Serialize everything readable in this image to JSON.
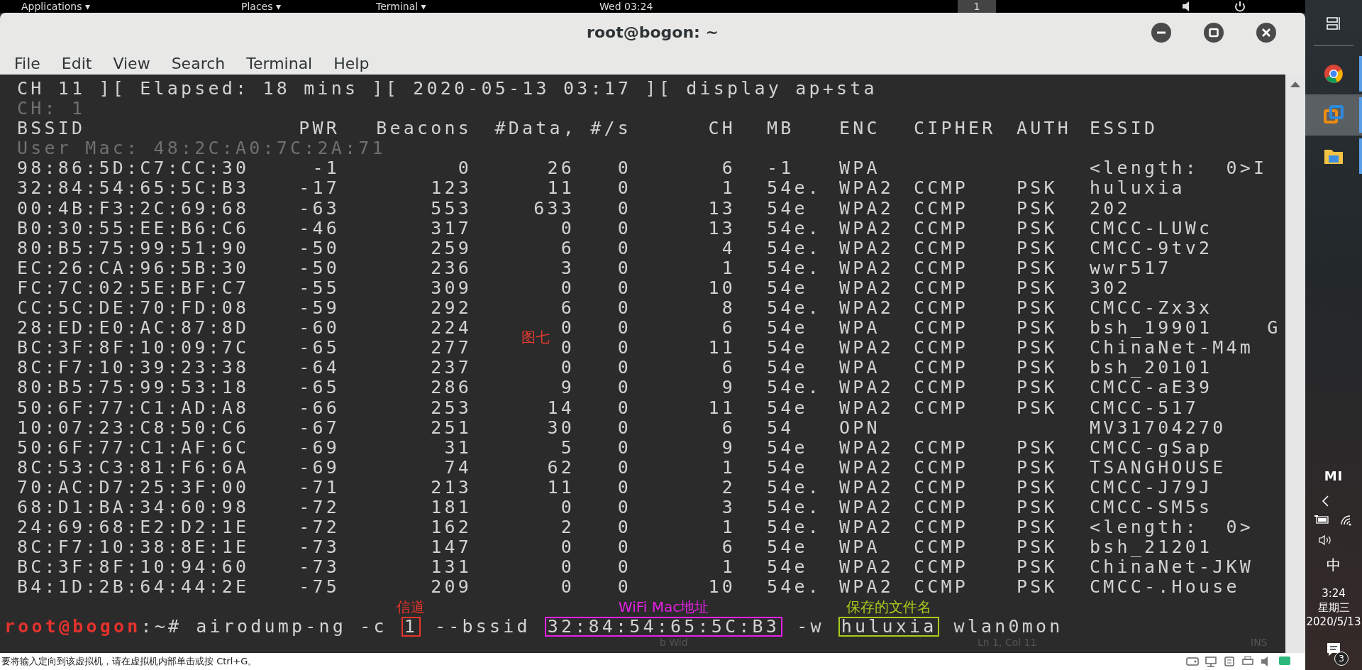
{
  "top_bar": {
    "menus": [
      "Applications ▾",
      "Places ▾",
      "Terminal ▾"
    ],
    "clock": "Wed 03:24",
    "workspace": "1"
  },
  "window": {
    "title": "root@bogon: ~"
  },
  "menu": [
    "File",
    "Edit",
    "View",
    "Search",
    "Terminal",
    "Help"
  ],
  "terminal": {
    "status_line": "CH 11 ][ Elapsed: 18 mins ][ 2020-05-13 03:17 ][ display ap+sta",
    "channel_line": "CH: 1",
    "columns": [
      "BSSID",
      "PWR",
      "Beacons",
      "#Data, #/s",
      "CH",
      "MB",
      "ENC",
      "CIPHER",
      "AUTH",
      "ESSID"
    ],
    "user_mac_line": "User Mac: 48:2C:A0:7C:2A:71",
    "rows": [
      {
        "bssid": "98:86:5D:C7:CC:30",
        "pwr": "-1",
        "beacons": "0",
        "data": "26",
        "rate": "0",
        "ch": "6",
        "mb": "-1",
        "enc": "WPA",
        "essid": "<length:  0>I"
      },
      {
        "bssid": "32:84:54:65:5C:B3",
        "pwr": "-17",
        "beacons": "123",
        "data": "11",
        "rate": "0",
        "ch": "1",
        "mb": "54e.",
        "enc": "WPA2",
        "cipher": "CCMP",
        "auth": "PSK",
        "essid": "huluxia"
      },
      {
        "bssid": "00:4B:F3:2C:69:68",
        "pwr": "-63",
        "beacons": "553",
        "data": "633",
        "rate": "0",
        "ch": "13",
        "mb": "54e",
        "enc": "WPA2",
        "cipher": "CCMP",
        "auth": "PSK",
        "essid": "202"
      },
      {
        "bssid": "B0:30:55:EE:B6:C6",
        "pwr": "-46",
        "beacons": "317",
        "data": "0",
        "rate": "0",
        "ch": "13",
        "mb": "54e.",
        "enc": "WPA2",
        "cipher": "CCMP",
        "auth": "PSK",
        "essid": "CMCC-LUWc"
      },
      {
        "bssid": "80:B5:75:99:51:90",
        "pwr": "-50",
        "beacons": "259",
        "data": "6",
        "rate": "0",
        "ch": "4",
        "mb": "54e.",
        "enc": "WPA2",
        "cipher": "CCMP",
        "auth": "PSK",
        "essid": "CMCC-9tv2"
      },
      {
        "bssid": "EC:26:CA:96:5B:30",
        "pwr": "-50",
        "beacons": "236",
        "data": "3",
        "rate": "0",
        "ch": "1",
        "mb": "54e.",
        "enc": "WPA2",
        "cipher": "CCMP",
        "auth": "PSK",
        "essid": "wwr517"
      },
      {
        "bssid": "FC:7C:02:5E:BF:C7",
        "pwr": "-55",
        "beacons": "309",
        "data": "0",
        "rate": "0",
        "ch": "10",
        "mb": "54e",
        "enc": "WPA2",
        "cipher": "CCMP",
        "auth": "PSK",
        "essid": "302"
      },
      {
        "bssid": "CC:5C:DE:70:FD:08",
        "pwr": "-59",
        "beacons": "292",
        "data": "6",
        "rate": "0",
        "ch": "8",
        "mb": "54e.",
        "enc": "WPA2",
        "cipher": "CCMP",
        "auth": "PSK",
        "essid": "CMCC-Zx3x"
      },
      {
        "bssid": "28:ED:E0:AC:87:8D",
        "pwr": "-60",
        "beacons": "224",
        "data": "0",
        "rate": "0",
        "ch": "6",
        "mb": "54e",
        "enc": "WPA",
        "cipher": "CCMP",
        "auth": "PSK",
        "essid": "bsh_19901    G"
      },
      {
        "bssid": "BC:3F:8F:10:09:7C",
        "pwr": "-65",
        "beacons": "277",
        "data": "0",
        "rate": "0",
        "ch": "11",
        "mb": "54e",
        "enc": "WPA2",
        "cipher": "CCMP",
        "auth": "PSK",
        "essid": "ChinaNet-M4m"
      },
      {
        "bssid": "8C:F7:10:39:23:38",
        "pwr": "-64",
        "beacons": "237",
        "data": "0",
        "rate": "0",
        "ch": "6",
        "mb": "54e",
        "enc": "WPA",
        "cipher": "CCMP",
        "auth": "PSK",
        "essid": "bsh_20101"
      },
      {
        "bssid": "80:B5:75:99:53:18",
        "pwr": "-65",
        "beacons": "286",
        "data": "9",
        "rate": "0",
        "ch": "9",
        "mb": "54e.",
        "enc": "WPA2",
        "cipher": "CCMP",
        "auth": "PSK",
        "essid": "CMCC-aE39"
      },
      {
        "bssid": "50:6F:77:C1:AD:A8",
        "pwr": "-66",
        "beacons": "253",
        "data": "14",
        "rate": "0",
        "ch": "11",
        "mb": "54e",
        "enc": "WPA2",
        "cipher": "CCMP",
        "auth": "PSK",
        "essid": "CMCC-517"
      },
      {
        "bssid": "10:07:23:C8:50:C6",
        "pwr": "-67",
        "beacons": "251",
        "data": "30",
        "rate": "0",
        "ch": "6",
        "mb": "54",
        "enc": "OPN",
        "essid": "MV31704270"
      },
      {
        "bssid": "50:6F:77:C1:AF:6C",
        "pwr": "-69",
        "beacons": "31",
        "data": "5",
        "rate": "0",
        "ch": "9",
        "mb": "54e",
        "enc": "WPA2",
        "cipher": "CCMP",
        "auth": "PSK",
        "essid": "CMCC-gSap"
      },
      {
        "bssid": "8C:53:C3:81:F6:6A",
        "pwr": "-69",
        "beacons": "74",
        "data": "62",
        "rate": "0",
        "ch": "1",
        "mb": "54e",
        "enc": "WPA2",
        "cipher": "CCMP",
        "auth": "PSK",
        "essid": "TSANGHOUSE"
      },
      {
        "bssid": "70:AC:D7:25:3F:00",
        "pwr": "-71",
        "beacons": "213",
        "data": "11",
        "rate": "0",
        "ch": "2",
        "mb": "54e.",
        "enc": "WPA2",
        "cipher": "CCMP",
        "auth": "PSK",
        "essid": "CMCC-J79J"
      },
      {
        "bssid": "68:D1:BA:34:60:98",
        "pwr": "-72",
        "beacons": "181",
        "data": "0",
        "rate": "0",
        "ch": "3",
        "mb": "54e.",
        "enc": "WPA2",
        "cipher": "CCMP",
        "auth": "PSK",
        "essid": "CMCC-SM5s"
      },
      {
        "bssid": "24:69:68:E2:D2:1E",
        "pwr": "-72",
        "beacons": "162",
        "data": "2",
        "rate": "0",
        "ch": "1",
        "mb": "54e.",
        "enc": "WPA2",
        "cipher": "CCMP",
        "auth": "PSK",
        "essid": "<length:  0>"
      },
      {
        "bssid": "8C:F7:10:38:8E:1E",
        "pwr": "-73",
        "beacons": "147",
        "data": "0",
        "rate": "0",
        "ch": "6",
        "mb": "54e",
        "enc": "WPA",
        "cipher": "CCMP",
        "auth": "PSK",
        "essid": "bsh_21201"
      },
      {
        "bssid": "BC:3F:8F:10:94:60",
        "pwr": "-73",
        "beacons": "131",
        "data": "0",
        "rate": "0",
        "ch": "1",
        "mb": "54e",
        "enc": "WPA2",
        "cipher": "CCMP",
        "auth": "PSK",
        "essid": "ChinaNet-JKW"
      },
      {
        "bssid": "B4:1D:2B:64:44:2E",
        "pwr": "-75",
        "beacons": "209",
        "data": "0",
        "rate": "0",
        "ch": "10",
        "mb": "54e.",
        "enc": "WPA2",
        "cipher": "CCMP",
        "auth": "PSK",
        "essid": "CMCC-.House"
      }
    ],
    "figure_label": "图七",
    "prompt_user": "root@bogon",
    "prompt_rest": ":~#",
    "command": [
      {
        "text": "airodump-ng -c"
      },
      {
        "text": "1",
        "note": "信道",
        "color": "#e8352b"
      },
      {
        "text": "--bssid"
      },
      {
        "text": "32:84:54:65:5C:B3",
        "note": "WiFi Mac地址",
        "color": "#e620e6"
      },
      {
        "text": "-w"
      },
      {
        "text": "huluxia",
        "note": "保存的文件名",
        "color": "#a8cc1c"
      },
      {
        "text": "wlan0mon"
      }
    ]
  },
  "hidden_editor_status": [
    "b Wid",
    "Ln 1, Col 11",
    "INS"
  ],
  "status_bar": {
    "message": "要将输入定向到该虚拟机，请在虚拟机内部单击或按 Ctrl+G。"
  },
  "taskbar": {
    "apps": [
      {
        "kind": "ring",
        "selected": false
      },
      {
        "kind": "squares",
        "selected": true
      },
      {
        "kind": "folder",
        "selected": false
      }
    ],
    "logo": "MI",
    "ime": "中",
    "time": "3:24",
    "weekday": "星期三",
    "date": "2020/5/13",
    "notifications": "3"
  }
}
